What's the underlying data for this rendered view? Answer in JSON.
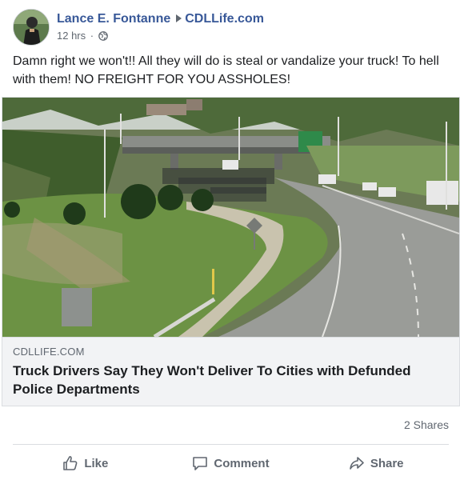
{
  "post": {
    "author": "Lance E. Fontanne",
    "page": "CDLLife.com",
    "time": "12 hrs",
    "separator": "·",
    "privacy_icon": "globe-icon",
    "text": "Damn right we won't!! All they will do is steal or vandalize your truck! To hell with them! NO FREIGHT FOR YOU ASSHOLES!"
  },
  "link": {
    "domain": "CDLLIFE.COM",
    "title": "Truck Drivers Say They Won't Deliver To Cities with Defunded Police Departments",
    "image_icon": "highway-protest-photo"
  },
  "stats": {
    "shares": "2 Shares"
  },
  "actions": {
    "like": "Like",
    "comment": "Comment",
    "share": "Share"
  },
  "colors": {
    "link_blue": "#385898",
    "meta_gray": "#606770",
    "card_bg": "#f2f3f5"
  }
}
